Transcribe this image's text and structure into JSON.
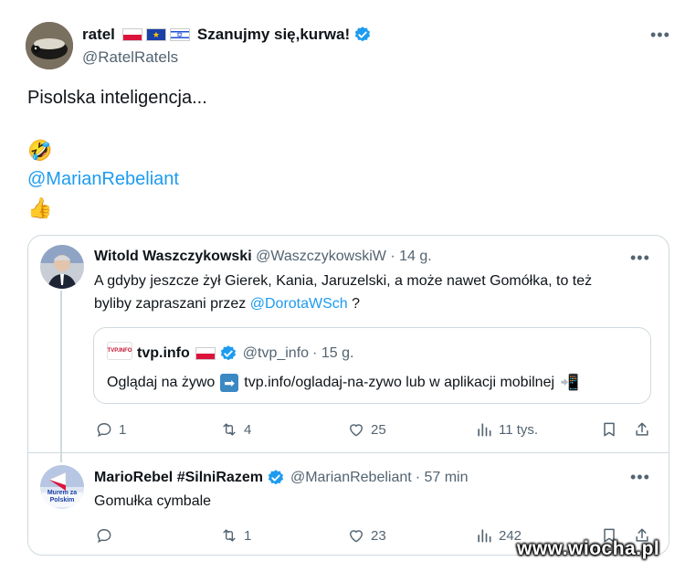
{
  "main_tweet": {
    "display_name": "ratel",
    "flags": [
      "flag-pl",
      "flag-eu",
      "flag-il"
    ],
    "name_suffix": "Szanujmy się,kurwa!",
    "handle": "@RatelRatels",
    "text_line1": "Pisolska inteligencja...",
    "emoji1": "🤣",
    "mention": "@MarianRebeliant",
    "emoji2": "👍"
  },
  "quote": {
    "post1": {
      "display_name": "Witold Waszczykowski",
      "handle": "@WaszczykowskiW",
      "time": "· 14 g.",
      "text_line1": "A gdyby jeszcze żył Gierek, Kania, Jaruzelski, a może nawet Gomółka, to też",
      "text_line2_prefix": "byliby zapraszani przez",
      "text_line2_mention": "@DorotaWSch",
      "text_line2_suffix": "?",
      "inner_quote": {
        "logo_text": "TVP.INFO",
        "display_name": "tvp.info",
        "handle": "@tvp_info",
        "time": "· 15 g.",
        "text_prefix": "Oglądaj na żywo",
        "arrow": "➡",
        "text_suffix": "tvp.info/ogladaj-na-zywo lub w aplikacji mobilnej",
        "phone": "📲"
      },
      "stats": {
        "replies": "1",
        "retweets": "4",
        "likes": "25",
        "views": "11 tys."
      }
    },
    "post2": {
      "display_name": "MarioRebel #SilniRazem",
      "handle": "@MarianRebeliant",
      "time": "· 57 min",
      "avatar_text": "Murem za\nPolskim",
      "text": "Gomułka cymbale",
      "stats": {
        "replies": "",
        "retweets": "1",
        "likes": "23",
        "views": "242"
      }
    }
  },
  "watermark": "www.wiocha.pl",
  "colors": {
    "link": "#1d9bf0",
    "muted": "#536471",
    "border": "#cfd9de",
    "verified": "#1d9bf0"
  }
}
